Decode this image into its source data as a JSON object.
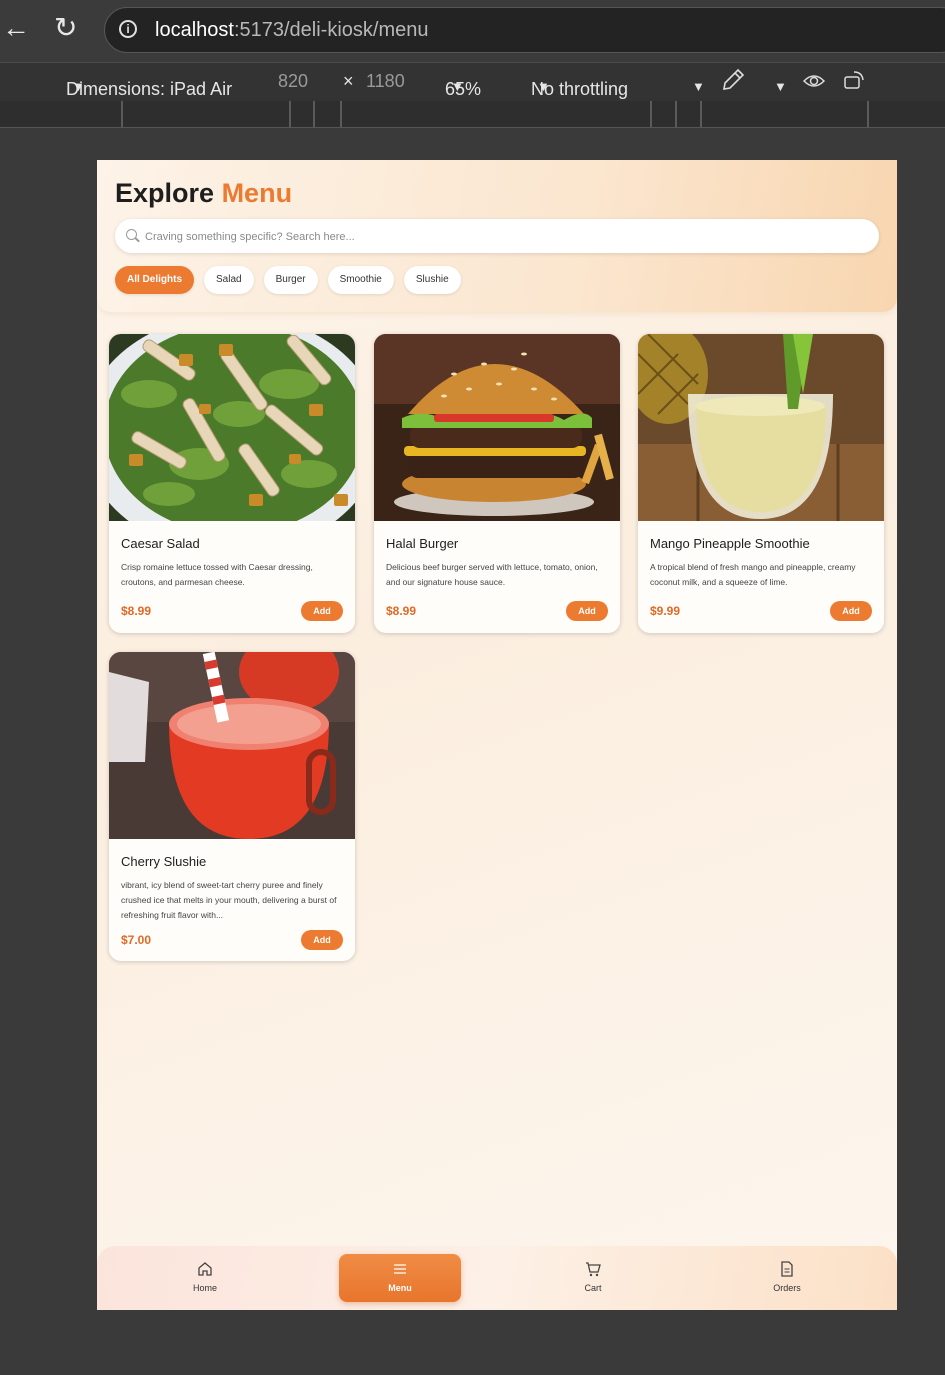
{
  "browser": {
    "url_host": "localhost",
    "url_path": ":5173/deli-kiosk/menu"
  },
  "devtools": {
    "dimensions_label": "Dimensions: iPad Air",
    "width": "820",
    "times": "×",
    "height": "1180",
    "zoom": "65%",
    "throttling": "No throttling"
  },
  "header": {
    "title_main": "Explore",
    "title_accent": "Menu",
    "search_placeholder": "Craving something specific? Search here..."
  },
  "categories": [
    "All Delights",
    "Salad",
    "Burger",
    "Smoothie",
    "Slushie"
  ],
  "active_category": "All Delights",
  "products": [
    {
      "name": "Caesar Salad",
      "description": "Crisp romaine lettuce tossed with Caesar dressing, croutons, and parmesan cheese.",
      "price": "$8.99",
      "add_label": "Add"
    },
    {
      "name": "Halal Burger",
      "description": "Delicious beef burger served with lettuce, tomato, onion, and our signature house sauce.",
      "price": "$8.99",
      "add_label": "Add"
    },
    {
      "name": "Mango Pineapple Smoothie",
      "description": "A tropical blend of fresh mango and pineapple, creamy coconut milk, and a squeeze of lime.",
      "price": "$9.99",
      "add_label": "Add"
    },
    {
      "name": "Cherry Slushie",
      "description": "vibrant, icy blend of sweet-tart cherry puree and finely crushed ice that melts in your mouth, delivering a burst of refreshing fruit flavor with...",
      "price": "$7.00",
      "add_label": "Add"
    }
  ],
  "bottom_nav": [
    {
      "label": "Home",
      "icon": "home-icon"
    },
    {
      "label": "Menu",
      "icon": "menu-icon",
      "active": true
    },
    {
      "label": "Cart",
      "icon": "cart-icon"
    },
    {
      "label": "Orders",
      "icon": "orders-icon"
    }
  ],
  "colors": {
    "accent": "#ec7a30",
    "price": "#e06a25"
  }
}
